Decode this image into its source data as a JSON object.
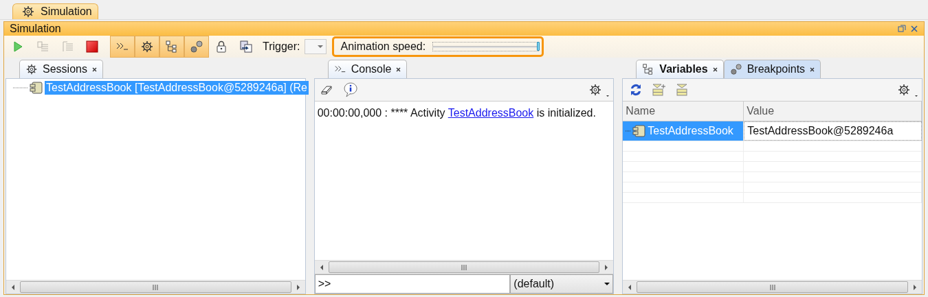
{
  "window_tab": {
    "label": "Simulation",
    "selected": true
  },
  "panel": {
    "title": "Simulation"
  },
  "toolbar": {
    "buttons": [
      {
        "kind": "play",
        "disabled": false,
        "on": false
      },
      {
        "kind": "step-into",
        "disabled": true,
        "on": false
      },
      {
        "kind": "step-over",
        "disabled": true,
        "on": false
      },
      {
        "kind": "stop",
        "disabled": false,
        "on": false
      },
      {
        "kind": "console",
        "disabled": false,
        "on": true
      },
      {
        "kind": "gear",
        "disabled": false,
        "on": true
      },
      {
        "kind": "tree",
        "disabled": false,
        "on": true
      },
      {
        "kind": "balls",
        "disabled": false,
        "on": true
      },
      {
        "kind": "lock",
        "disabled": false,
        "on": false
      },
      {
        "kind": "export",
        "disabled": false,
        "on": false
      }
    ],
    "trigger_label": "Trigger:",
    "animation_speed": {
      "label": "Animation speed:",
      "level": 1,
      "highlighted": true
    }
  },
  "sessions": {
    "tabs": [
      {
        "label": "Sessions",
        "kind": "gear",
        "selected": true
      }
    ],
    "tree": [
      {
        "label": "TestAddressBook [TestAddressBook@5289246a] (Re",
        "selected": true
      }
    ]
  },
  "console": {
    "tabs": [
      {
        "label": "Console",
        "kind": "console",
        "selected": true
      }
    ],
    "lines": [
      {
        "prefix": "00:00:00,000 : **** Activity ",
        "link": "TestAddressBook",
        "suffix": " is initialized."
      }
    ],
    "input": {
      "value": ">>"
    },
    "dropdown": {
      "value": "(default)"
    }
  },
  "variables": {
    "tabs": [
      {
        "label": "Variables",
        "kind": "tree",
        "selected": true
      },
      {
        "label": "Breakpoints",
        "kind": "balls",
        "selected": false
      }
    ],
    "columns": [
      "Name",
      "Value"
    ],
    "rows": [
      {
        "name": "TestAddressBook",
        "value": "TestAddressBook@5289246a",
        "selected": true
      }
    ]
  }
}
